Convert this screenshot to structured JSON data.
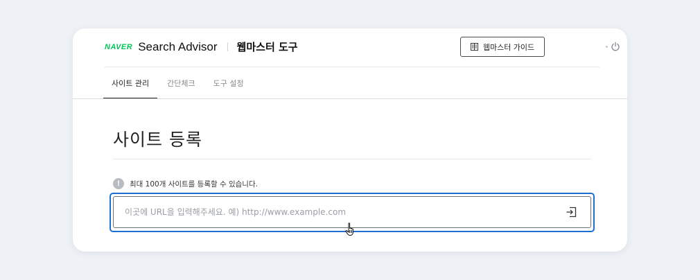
{
  "header": {
    "logo": "NAVER",
    "title": "Search Advisor",
    "subtitle": "웹마스터 도구",
    "guide_button_label": "웹마스터 가이드",
    "guide_icon": "book-icon",
    "power_icon": "power-icon"
  },
  "tabs": [
    {
      "label": "사이트 관리",
      "active": true
    },
    {
      "label": "간단체크",
      "active": false
    },
    {
      "label": "도구 설정",
      "active": false
    }
  ],
  "main": {
    "title": "사이트 등록",
    "notice_icon": "!",
    "notice": "최대 100개 사이트를 등록할 수 있습니다.",
    "url_input": {
      "placeholder": "이곳에 URL을 입력해주세요. 예) http://www.example.com",
      "value": ""
    },
    "submit_icon": "login-arrow-icon"
  },
  "colors": {
    "brand": "#03c75a",
    "focus": "#1c6fd1",
    "background": "#eef1f5"
  }
}
